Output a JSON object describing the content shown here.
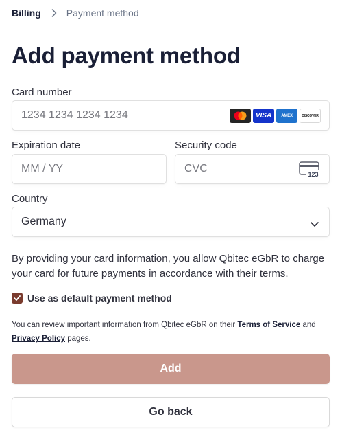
{
  "breadcrumb": {
    "parent": "Billing",
    "current": "Payment method"
  },
  "page": {
    "title": "Add payment method"
  },
  "form": {
    "card_number": {
      "label": "Card number",
      "placeholder": "1234 1234 1234 1234",
      "value": "",
      "brands": [
        {
          "name": "mastercard-icon",
          "text": ""
        },
        {
          "name": "visa-icon",
          "text": "VISA"
        },
        {
          "name": "amex-icon",
          "text": "AMEX"
        },
        {
          "name": "discover-icon",
          "text": "DISCOVER"
        }
      ]
    },
    "expiration": {
      "label": "Expiration date",
      "placeholder": "MM / YY",
      "value": ""
    },
    "security_code": {
      "label": "Security code",
      "placeholder": "CVC",
      "value": "",
      "icon_text": "123"
    },
    "country": {
      "label": "Country",
      "value": "Germany"
    }
  },
  "disclaimer": "By providing your card information, you allow Qbitec eGbR to charge your card for future payments in accordance with their terms.",
  "default_method": {
    "label": "Use as default payment method",
    "checked": true
  },
  "terms": {
    "prefix": "You can review important information from Qbitec eGbR on their ",
    "tos_link": "Terms of Service",
    "middle": " and ",
    "privacy_link": "Privacy Policy",
    "suffix": " pages."
  },
  "buttons": {
    "add": "Add",
    "back": "Go back"
  },
  "colors": {
    "accent": "#7a3b2e",
    "add_button": "#c9978c",
    "heading": "#1a1f36"
  }
}
